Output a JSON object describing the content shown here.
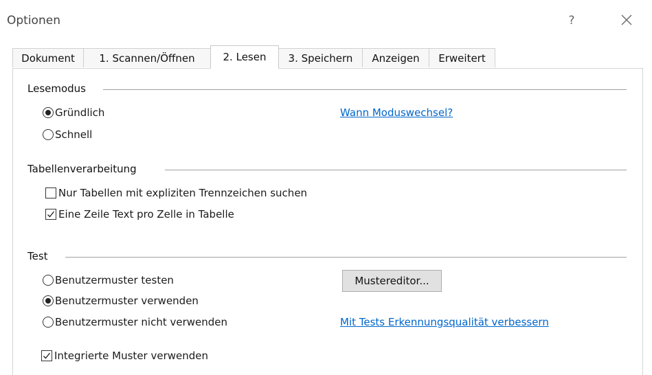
{
  "window": {
    "title": "Optionen",
    "help_label": "?",
    "close_icon": "close-icon"
  },
  "tabs": [
    {
      "label": "Dokument",
      "active": false
    },
    {
      "label": "1. Scannen/Öffnen",
      "active": false
    },
    {
      "label": "2. Lesen",
      "active": true
    },
    {
      "label": "3. Speichern",
      "active": false
    },
    {
      "label": "Anzeigen",
      "active": false
    },
    {
      "label": "Erweitert",
      "active": false
    }
  ],
  "lesemodus": {
    "label": "Lesemodus",
    "options": [
      {
        "label": "Gründlich",
        "checked": true
      },
      {
        "label": "Schnell",
        "checked": false
      }
    ],
    "link": "Wann Moduswechsel?"
  },
  "tabellen": {
    "label": "Tabellenverarbeitung",
    "options": [
      {
        "label": "Nur Tabellen mit expliziten Trennzeichen suchen",
        "checked": false
      },
      {
        "label": "Eine Zeile Text pro Zelle in Tabelle",
        "checked": true
      }
    ]
  },
  "test": {
    "label": "Test",
    "options": [
      {
        "label": "Benutzermuster testen",
        "checked": false
      },
      {
        "label": "Benutzermuster verwenden",
        "checked": true
      },
      {
        "label": "Benutzermuster nicht verwenden",
        "checked": false
      }
    ],
    "button": "Mustereditor...",
    "link": "Mit Tests Erkennungsqualität verbessern",
    "builtin": {
      "label": "Integrierte Muster verwenden",
      "checked": true
    }
  },
  "colors": {
    "link": "#0066cc",
    "radio_dot": "#222222",
    "button_bg": "#e1e1e1"
  }
}
